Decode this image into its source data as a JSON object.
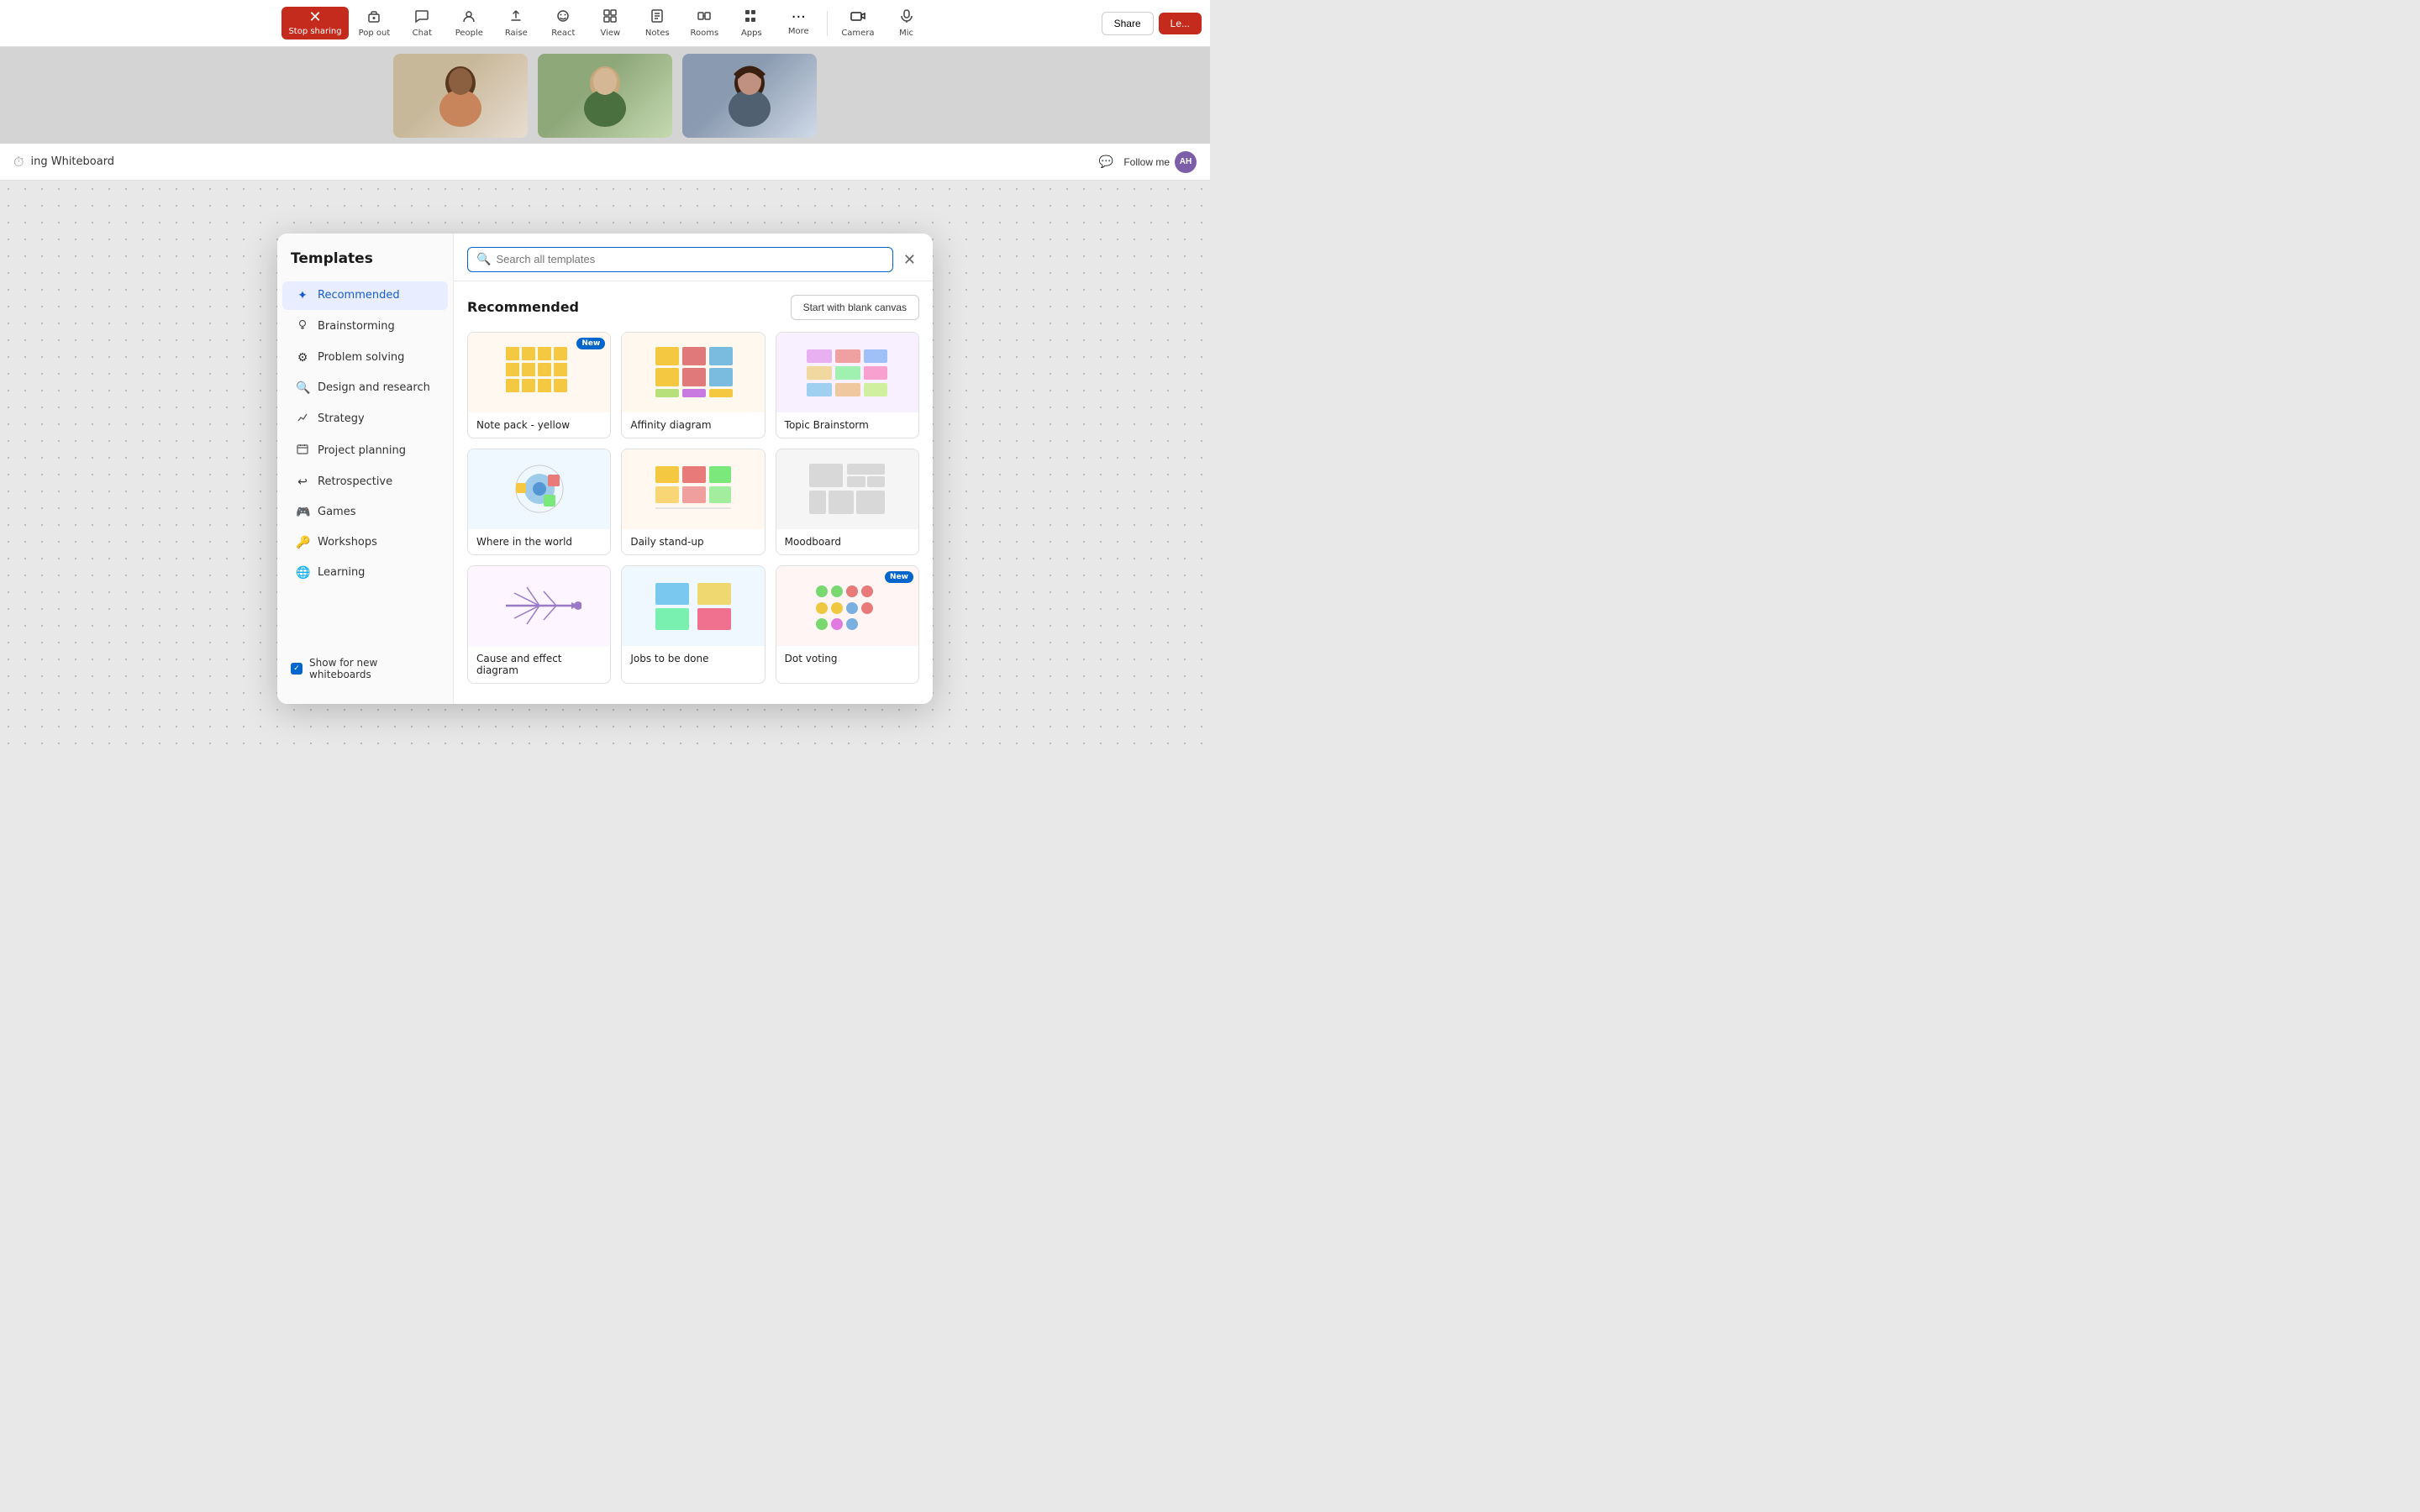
{
  "toolbar": {
    "items": [
      {
        "id": "stop-sharing",
        "label": "Stop sharing",
        "icon": "✕"
      },
      {
        "id": "pop-out",
        "label": "Pop out",
        "icon": "⬡"
      },
      {
        "id": "chat",
        "label": "Chat",
        "icon": "💬"
      },
      {
        "id": "people",
        "label": "People",
        "icon": "👤"
      },
      {
        "id": "raise",
        "label": "Raise",
        "icon": "✋"
      },
      {
        "id": "react",
        "label": "React",
        "icon": "😊"
      },
      {
        "id": "view",
        "label": "View",
        "icon": "⊞"
      },
      {
        "id": "notes",
        "label": "Notes",
        "icon": "📄"
      },
      {
        "id": "rooms",
        "label": "Rooms",
        "icon": "⬡"
      },
      {
        "id": "apps",
        "label": "Apps",
        "icon": "⊞"
      },
      {
        "id": "more",
        "label": "More",
        "icon": "···"
      },
      {
        "id": "camera",
        "label": "Camera",
        "icon": "📷"
      },
      {
        "id": "mic",
        "label": "Mic",
        "icon": "🎤"
      },
      {
        "id": "share",
        "label": "Share",
        "icon": "↑"
      }
    ],
    "stop_btn_label": "Stop sharing",
    "share_btn_label": "Share"
  },
  "whiteboard": {
    "title": "ing Whiteboard",
    "follow_me_label": "Follow me",
    "avatar_initials": "AH"
  },
  "modal": {
    "title": "Templates",
    "search_placeholder": "Search all templates",
    "close_icon": "✕",
    "section_title": "Recommended",
    "blank_canvas_btn": "Start with blank canvas",
    "show_for_new": "Show for new whiteboards",
    "sidebar_items": [
      {
        "id": "recommended",
        "label": "Recommended",
        "icon": "✦",
        "active": true
      },
      {
        "id": "brainstorming",
        "label": "Brainstorming",
        "icon": "💡",
        "active": false
      },
      {
        "id": "problem-solving",
        "label": "Problem solving",
        "icon": "⚙",
        "active": false
      },
      {
        "id": "design-research",
        "label": "Design and research",
        "icon": "🔍",
        "active": false
      },
      {
        "id": "strategy",
        "label": "Strategy",
        "icon": "📈",
        "active": false
      },
      {
        "id": "project-planning",
        "label": "Project planning",
        "icon": "☰",
        "active": false
      },
      {
        "id": "retrospective",
        "label": "Retrospective",
        "icon": "↩",
        "active": false
      },
      {
        "id": "games",
        "label": "Games",
        "icon": "🎮",
        "active": false
      },
      {
        "id": "workshops",
        "label": "Workshops",
        "icon": "🔑",
        "active": false
      },
      {
        "id": "learning",
        "label": "Learning",
        "icon": "🌐",
        "active": false
      }
    ],
    "templates": [
      {
        "id": "note-yellow",
        "label": "Note pack - yellow",
        "new": true,
        "thumb_type": "note-yellow"
      },
      {
        "id": "affinity",
        "label": "Affinity diagram",
        "new": false,
        "thumb_type": "affinity"
      },
      {
        "id": "topic-brainstorm",
        "label": "Topic Brainstorm",
        "new": false,
        "thumb_type": "topic"
      },
      {
        "id": "where-world",
        "label": "Where in the world",
        "new": false,
        "thumb_type": "where"
      },
      {
        "id": "daily-standup",
        "label": "Daily stand-up",
        "new": false,
        "thumb_type": "daily"
      },
      {
        "id": "moodboard",
        "label": "Moodboard",
        "new": false,
        "thumb_type": "mood"
      },
      {
        "id": "cause-effect",
        "label": "Cause and effect diagram",
        "new": false,
        "thumb_type": "cause"
      },
      {
        "id": "jobs-to-be-done",
        "label": "Jobs to be done",
        "new": false,
        "thumb_type": "jobs"
      },
      {
        "id": "dot-voting",
        "label": "Dot voting",
        "new": true,
        "thumb_type": "dot"
      }
    ]
  }
}
